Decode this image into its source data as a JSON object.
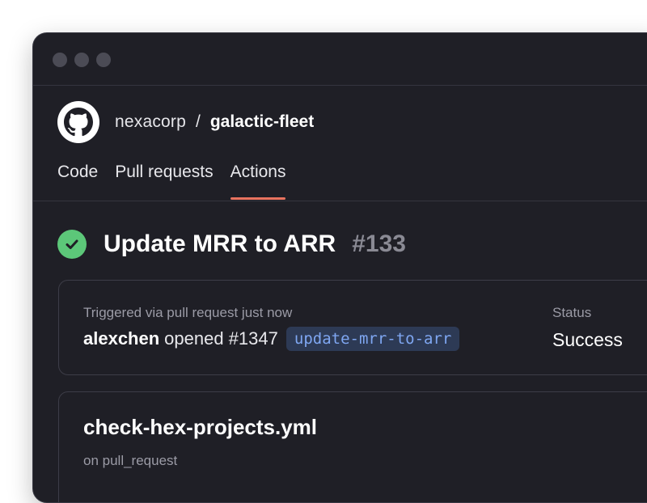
{
  "window": {
    "controls": [
      "dot",
      "dot",
      "dot"
    ]
  },
  "repo": {
    "owner": "nexacorp",
    "separator": "/",
    "name": "galactic-fleet"
  },
  "tabs": [
    {
      "label": "Code",
      "active": false
    },
    {
      "label": "Pull requests",
      "active": false
    },
    {
      "label": "Actions",
      "active": true
    }
  ],
  "run": {
    "title": "Update MRR to ARR",
    "number": "#133",
    "status_icon": "check-circle-icon"
  },
  "trigger": {
    "label": "Triggered via pull request just now",
    "actor": "alexchen",
    "action": "opened #1347",
    "branch": "update-mrr-to-arr",
    "status_label": "Status",
    "status_value": "Success"
  },
  "workflow": {
    "name": "check-hex-projects.yml",
    "event": "on pull_request"
  },
  "colors": {
    "accent": "#e8735f",
    "success": "#5cc779",
    "branch_text": "#7fa7f2",
    "branch_bg": "#2d3a55"
  }
}
